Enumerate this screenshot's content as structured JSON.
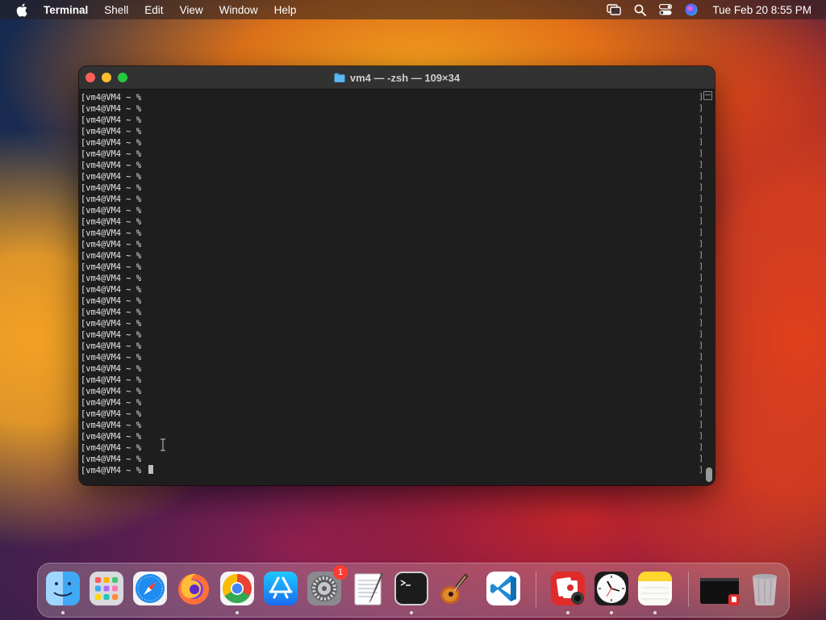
{
  "menubar": {
    "app_name": "Terminal",
    "menus": [
      "Shell",
      "Edit",
      "View",
      "Window",
      "Help"
    ],
    "clock": "Tue Feb 20  8:55 PM"
  },
  "window": {
    "title": "vm4 — -zsh — 109×34",
    "prompt": "[vm4@VM4 ~ % ",
    "prompt_lines": 34
  },
  "dock": {
    "items": [
      {
        "name": "Finder",
        "icon": "finder-icon"
      },
      {
        "name": "Launchpad",
        "icon": "launchpad-icon"
      },
      {
        "name": "Safari",
        "icon": "safari-icon"
      },
      {
        "name": "Firefox",
        "icon": "firefox-icon"
      },
      {
        "name": "Google Chrome",
        "icon": "chrome-icon"
      },
      {
        "name": "App Store",
        "icon": "app-store-icon"
      },
      {
        "name": "System Settings",
        "icon": "settings-icon",
        "badge": "1"
      },
      {
        "name": "TextEdit",
        "icon": "textedit-icon"
      },
      {
        "name": "Terminal",
        "icon": "terminal-icon"
      },
      {
        "name": "GarageBand",
        "icon": "garageband-icon"
      },
      {
        "name": "Visual Studio Code",
        "icon": "vscode-icon"
      },
      {
        "name": "Photo Booth",
        "icon": "photo-booth-icon"
      },
      {
        "name": "Clock",
        "icon": "clock-icon"
      },
      {
        "name": "Notes",
        "icon": "notes-icon"
      },
      {
        "name": "Recent Window",
        "icon": "window-thumbnail-icon"
      },
      {
        "name": "Trash",
        "icon": "trash-icon"
      }
    ]
  }
}
